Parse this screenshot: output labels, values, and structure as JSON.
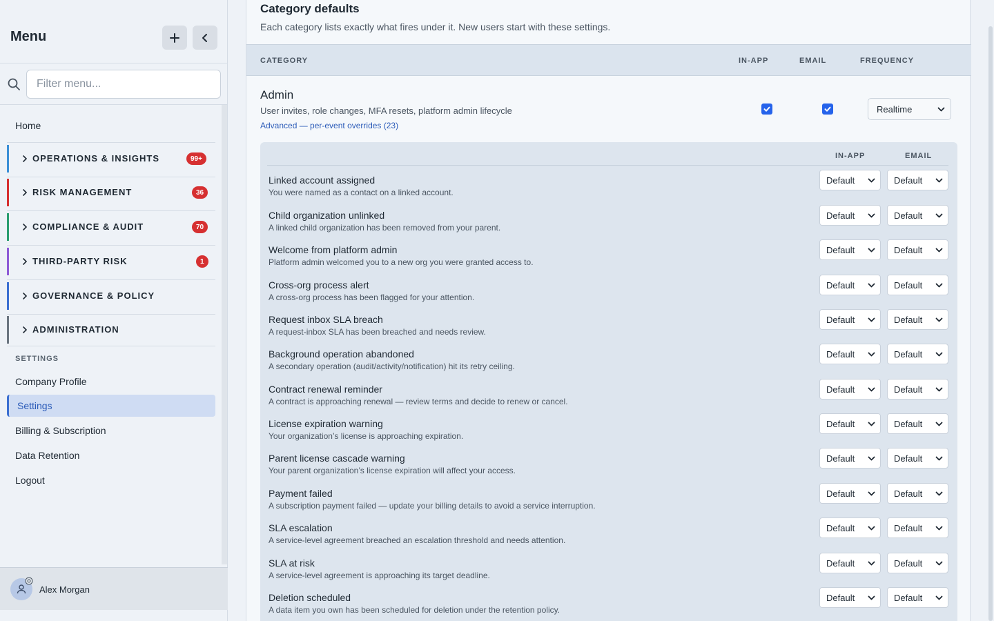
{
  "sidebar": {
    "title": "Menu",
    "filter_placeholder": "Filter menu...",
    "home": "Home",
    "groups": [
      {
        "label": "OPERATIONS & INSIGHTS",
        "badge": "99+",
        "color": "#3b8fd6"
      },
      {
        "label": "RISK MANAGEMENT",
        "badge": "36",
        "color": "#d63031"
      },
      {
        "label": "COMPLIANCE & AUDIT",
        "badge": "70",
        "color": "#2a9d6f"
      },
      {
        "label": "THIRD-PARTY RISK",
        "badge": "1",
        "color": "#8e5bd6"
      },
      {
        "label": "GOVERNANCE & POLICY",
        "badge": "",
        "color": "#3b6fd1"
      },
      {
        "label": "ADMINISTRATION",
        "badge": "",
        "color": "#6b7580"
      }
    ],
    "settings_header": "SETTINGS",
    "settings_items": [
      "Company Profile",
      "Settings",
      "Billing & Subscription",
      "Data Retention",
      "Logout"
    ],
    "active_item": "Settings",
    "user_name": "Alex Morgan"
  },
  "main": {
    "title": "Category defaults",
    "subtitle": "Each category lists exactly what fires under it. New users start with these settings.",
    "columns": {
      "category": "CATEGORY",
      "in_app": "IN-APP",
      "email": "EMAIL",
      "frequency": "FREQUENCY"
    },
    "category": {
      "name": "Admin",
      "description": "User invites, role changes, MFA resets, platform admin lifecycle",
      "advanced_link": "Advanced — per-event overrides (23)",
      "in_app_checked": true,
      "email_checked": true,
      "frequency": "Realtime"
    },
    "panel_columns": {
      "in_app": "IN-APP",
      "email": "EMAIL"
    },
    "events": [
      {
        "title": "Linked account assigned",
        "desc": "You were named as a contact on a linked account.",
        "in_app": "Default",
        "email": "Default"
      },
      {
        "title": "Child organization unlinked",
        "desc": "A linked child organization has been removed from your parent.",
        "in_app": "Default",
        "email": "Default"
      },
      {
        "title": "Welcome from platform admin",
        "desc": "Platform admin welcomed you to a new org you were granted access to.",
        "in_app": "Default",
        "email": "Default"
      },
      {
        "title": "Cross-org process alert",
        "desc": "A cross-org process has been flagged for your attention.",
        "in_app": "Default",
        "email": "Default"
      },
      {
        "title": "Request inbox SLA breach",
        "desc": "A request-inbox SLA has been breached and needs review.",
        "in_app": "Default",
        "email": "Default"
      },
      {
        "title": "Background operation abandoned",
        "desc": "A secondary operation (audit/activity/notification) hit its retry ceiling.",
        "in_app": "Default",
        "email": "Default"
      },
      {
        "title": "Contract renewal reminder",
        "desc": "A contract is approaching renewal — review terms and decide to renew or cancel.",
        "in_app": "Default",
        "email": "Default"
      },
      {
        "title": "License expiration warning",
        "desc": "Your organization’s license is approaching expiration.",
        "in_app": "Default",
        "email": "Default"
      },
      {
        "title": "Parent license cascade warning",
        "desc": "Your parent organization’s license expiration will affect your access.",
        "in_app": "Default",
        "email": "Default"
      },
      {
        "title": "Payment failed",
        "desc": "A subscription payment failed — update your billing details to avoid a service interruption.",
        "in_app": "Default",
        "email": "Default"
      },
      {
        "title": "SLA escalation",
        "desc": "A service-level agreement breached an escalation threshold and needs attention.",
        "in_app": "Default",
        "email": "Default"
      },
      {
        "title": "SLA at risk",
        "desc": "A service-level agreement is approaching its target deadline.",
        "in_app": "Default",
        "email": "Default"
      },
      {
        "title": "Deletion scheduled",
        "desc": "A data item you own has been scheduled for deletion under the retention policy.",
        "in_app": "Default",
        "email": "Default"
      }
    ]
  },
  "icons": {
    "add": "plus-icon",
    "collapse": "chevron-left-icon",
    "search": "search-icon",
    "group_chevron": "chevron-right-icon",
    "select_chevron": "chevron-down-icon",
    "avatar": "user-icon",
    "avatar_badge": "gear-icon"
  }
}
